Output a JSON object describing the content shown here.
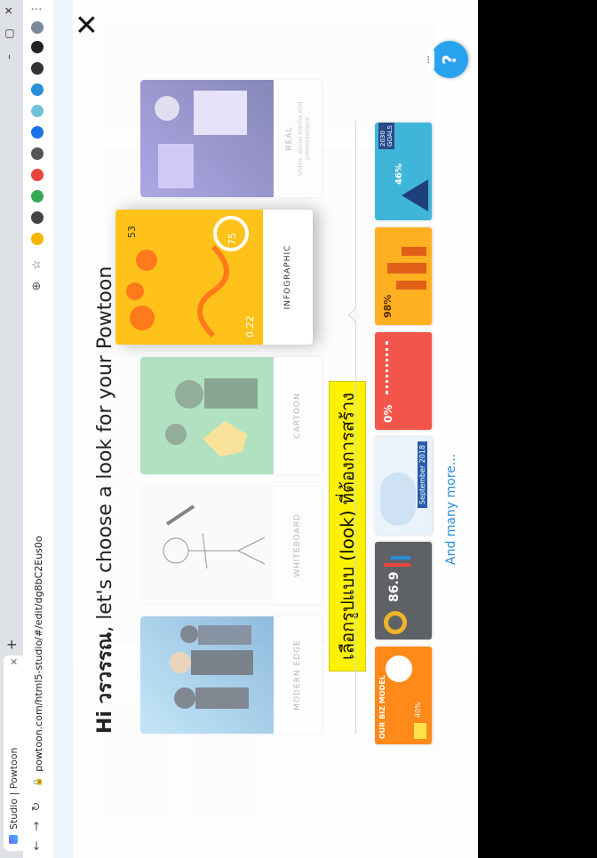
{
  "browser": {
    "tab_title": "Studio | Powtoon",
    "tab_close": "×",
    "new_tab": "+",
    "url": "powtoon.com/html5-studio/#/edit/dg8bC2Eus0o",
    "window_controls": [
      "–",
      "▢",
      "✕"
    ]
  },
  "modal": {
    "close": "✕",
    "greeting": "Hi",
    "user_name": "วรวรรณ",
    "heading_rest": ", let's choose a look for your Powtoon",
    "help": "?",
    "help_dots": "···",
    "caption": "เลือกรูปแบบ (look) ที่ต้องการสร้าง",
    "more_link": "And many more...",
    "styles": [
      {
        "label": "MODERN EDGE",
        "sub": ""
      },
      {
        "label": "WHITEBOARD",
        "sub": ""
      },
      {
        "label": "CARTOON",
        "sub": ""
      },
      {
        "label": "INFOGRAPHIC",
        "sub": ""
      },
      {
        "label": "REAL",
        "sub": "Video, social media and presentations"
      }
    ],
    "infographic_numbers": [
      "53",
      "75",
      "0.22"
    ],
    "thumbnails": [
      {
        "title": "OUR BIZ MODEL",
        "value": "40%"
      },
      {
        "title": "",
        "value": "86.9"
      },
      {
        "title": "September 2018",
        "value": ""
      },
      {
        "title": "",
        "value": "0%"
      },
      {
        "title": "",
        "value": "98%"
      },
      {
        "title": "2030 GOALS",
        "value": "46%"
      }
    ]
  },
  "colors": {
    "accent": "#2a8fd9",
    "highlight": "#fff200",
    "infographic": "#ffc21a"
  }
}
